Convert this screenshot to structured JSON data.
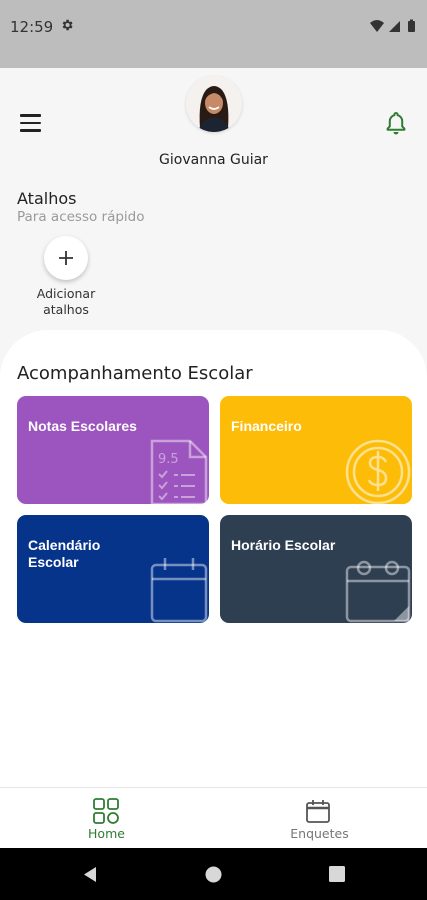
{
  "status_bar": {
    "time": "12:59",
    "left_icon": "gear-icon",
    "right_icons": [
      "wifi-icon",
      "signal-icon",
      "battery-icon"
    ]
  },
  "header": {
    "menu_icon": "hamburger-menu-icon",
    "user_name": "Giovanna Guiar",
    "notification_icon": "bell-icon",
    "accent_color": "#2e7d32"
  },
  "shortcuts": {
    "title": "Atalhos",
    "subtitle": "Para acesso rápido",
    "add_button": {
      "icon": "plus-icon",
      "label": "Adicionar atalhos"
    }
  },
  "school": {
    "title": "Acompanhamento Escolar",
    "cards": [
      {
        "label": "Notas Escolares",
        "icon": "grades-sheet-icon",
        "icon_text": "9.5",
        "color": "#9c55be"
      },
      {
        "label": "Financeiro",
        "icon": "dollar-coin-icon",
        "color": "#fcbc08"
      },
      {
        "label": "Calendário Escolar",
        "icon": "calendar-icon",
        "color": "#07348b"
      },
      {
        "label": "Horário Escolar",
        "icon": "schedule-calendar-icon",
        "color": "#2f3f52"
      }
    ]
  },
  "bottom_nav": {
    "items": [
      {
        "label": "Home",
        "icon": "home-grid-icon",
        "active": true
      },
      {
        "label": "Enquetes",
        "icon": "polls-calendar-icon",
        "active": false
      }
    ]
  },
  "system_nav": {
    "buttons": [
      "back-icon",
      "home-circle-icon",
      "recents-icon"
    ]
  }
}
